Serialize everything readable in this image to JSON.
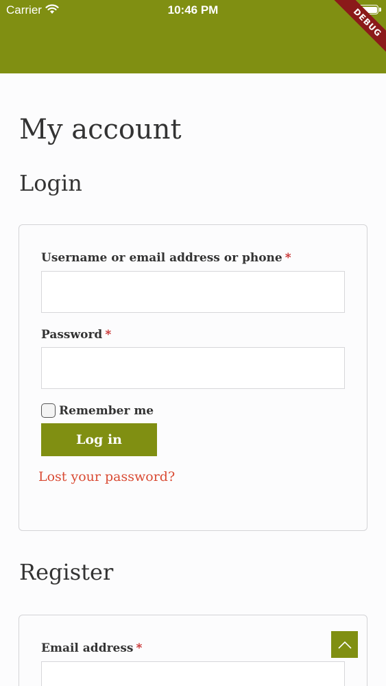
{
  "status_bar": {
    "carrier": "Carrier",
    "time": "10:46 PM",
    "debug_banner": "DEBUG"
  },
  "page": {
    "title": "My account"
  },
  "login": {
    "heading": "Login",
    "username_label": "Username or email address or phone",
    "username_value": "",
    "password_label": "Password",
    "password_value": "",
    "required_mark": "*",
    "remember_label": "Remember me",
    "remember_checked": false,
    "submit_label": "Log in",
    "lost_password_link": "Lost your password?"
  },
  "register": {
    "heading": "Register",
    "email_label": "Email address",
    "email_value": "",
    "required_mark": "*"
  },
  "icons": {
    "wifi": "wifi-icon",
    "battery": "battery-icon",
    "scroll_top": "chevron-up-icon"
  },
  "colors": {
    "brand": "#808f12",
    "link": "#d94a33",
    "required": "#c62828",
    "debug_banner": "#8b1a1a"
  }
}
